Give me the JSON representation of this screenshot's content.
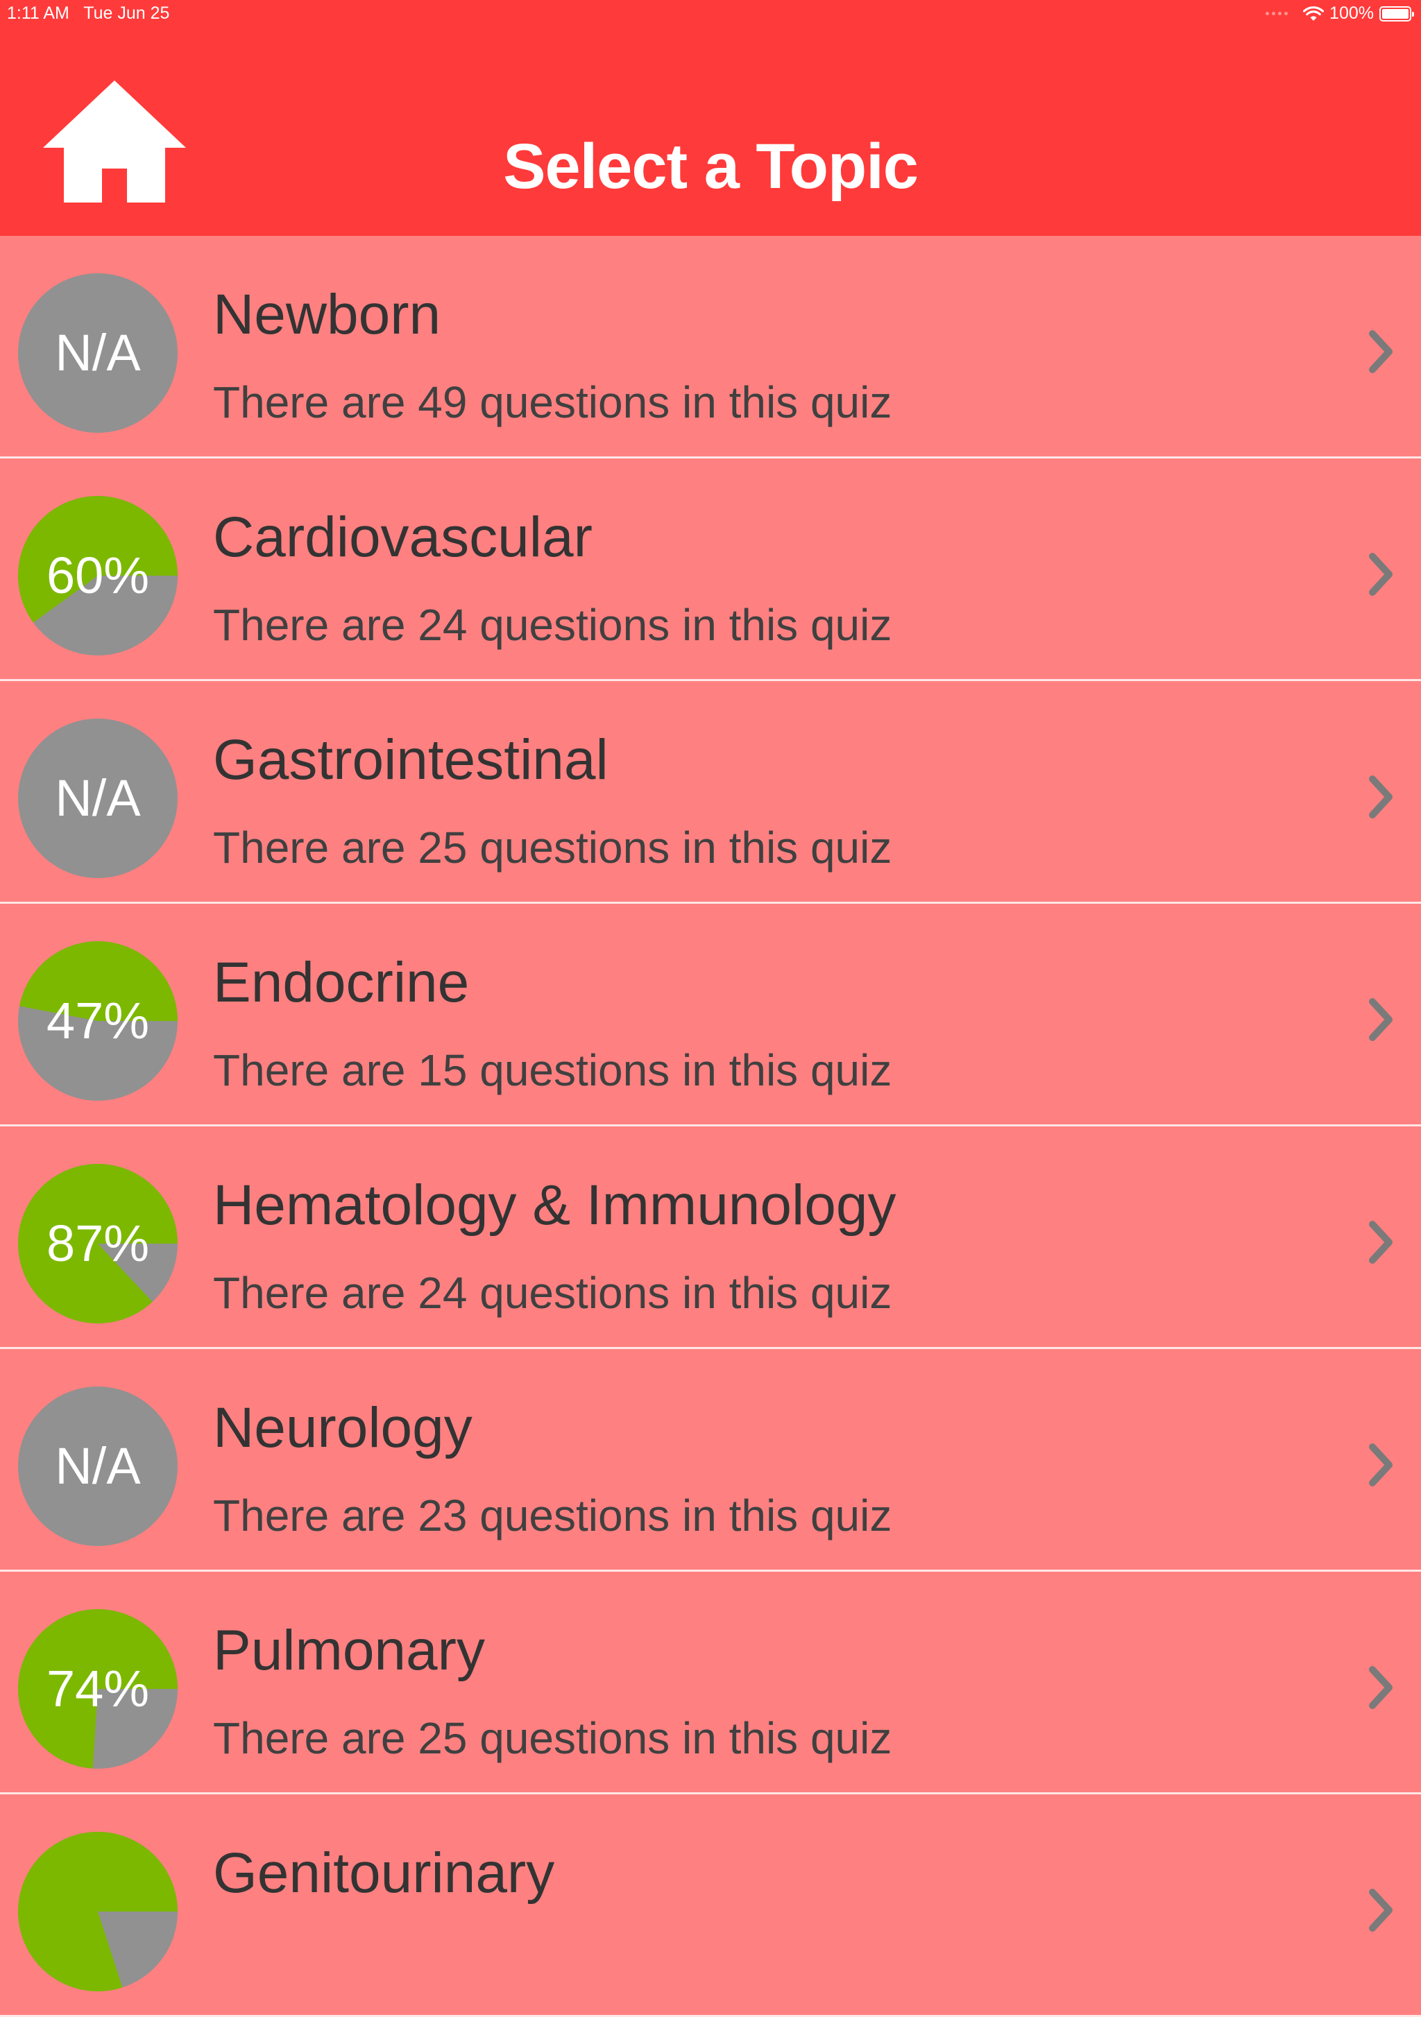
{
  "status_bar": {
    "time": "1:11 AM",
    "date": "Tue Jun 25",
    "battery": "100%",
    "wifi_icon": "wifi-icon",
    "battery_icon": "battery-full-icon"
  },
  "header": {
    "title": "Select a Topic",
    "home_icon": "home-icon"
  },
  "colors": {
    "header_bg": "#ff3a3a",
    "row_bg": "#ff8080",
    "score_fill": "#7cb800",
    "score_empty": "#919191"
  },
  "topics": [
    {
      "name": "Newborn",
      "count_text": "There are 49 questions in this quiz",
      "score_label": "N/A",
      "score_fraction": null
    },
    {
      "name": "Cardiovascular",
      "count_text": "There are 24 questions in this quiz",
      "score_label": "60%",
      "score_fraction": 0.6
    },
    {
      "name": "Gastrointestinal",
      "count_text": "There are 25 questions in this quiz",
      "score_label": "N/A",
      "score_fraction": null
    },
    {
      "name": "Endocrine",
      "count_text": "There are 15 questions in this quiz",
      "score_label": "47%",
      "score_fraction": 0.47
    },
    {
      "name": "Hematology & Immunology",
      "count_text": "There are 24 questions in this quiz",
      "score_label": "87%",
      "score_fraction": 0.87
    },
    {
      "name": "Neurology",
      "count_text": "There are 23 questions in this quiz",
      "score_label": "N/A",
      "score_fraction": null
    },
    {
      "name": "Pulmonary",
      "count_text": "There are 25 questions in this quiz",
      "score_label": "74%",
      "score_fraction": 0.74
    },
    {
      "name": "Genitourinary",
      "count_text": "",
      "score_label": "",
      "score_fraction": 0.8
    }
  ]
}
